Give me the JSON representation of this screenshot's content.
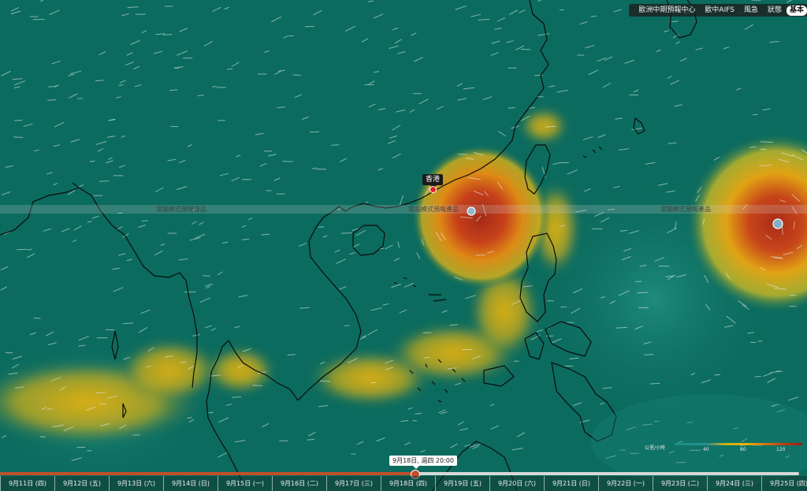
{
  "top_menu": {
    "items": [
      {
        "label": "歐洲中期預報中心",
        "active": false
      },
      {
        "label": "歐中AIFS",
        "active": false
      },
      {
        "label": "風急",
        "active": false
      },
      {
        "label": "狀態",
        "active": false
      },
      {
        "label": "基本",
        "active": true
      }
    ]
  },
  "watermark": "電腦模式預報產品",
  "location": {
    "name": "香港"
  },
  "legend": {
    "unit": "公里/小時",
    "ticks": [
      "40",
      "80",
      "120"
    ]
  },
  "timeline": {
    "current_label": "9月18日, 週四 20:00",
    "progress": 0.52,
    "days": [
      "9月11日 (四)",
      "9月12日 (五)",
      "9月13日 (六)",
      "9月14日 (日)",
      "9月15日 (一)",
      "9月16日 (二)",
      "9月17日 (三)",
      "9月18日 (四)",
      "9月19日 (五)",
      "9月20日 (六)",
      "9月21日 (日)",
      "9月22日 (一)",
      "9月23日 (二)",
      "9月24日 (三)",
      "9月25日 (四)"
    ]
  },
  "colors": {
    "calm": "#0b6b5e",
    "moderate": "#d9b414",
    "strong": "#c7411a",
    "accent": "#c0502a"
  }
}
